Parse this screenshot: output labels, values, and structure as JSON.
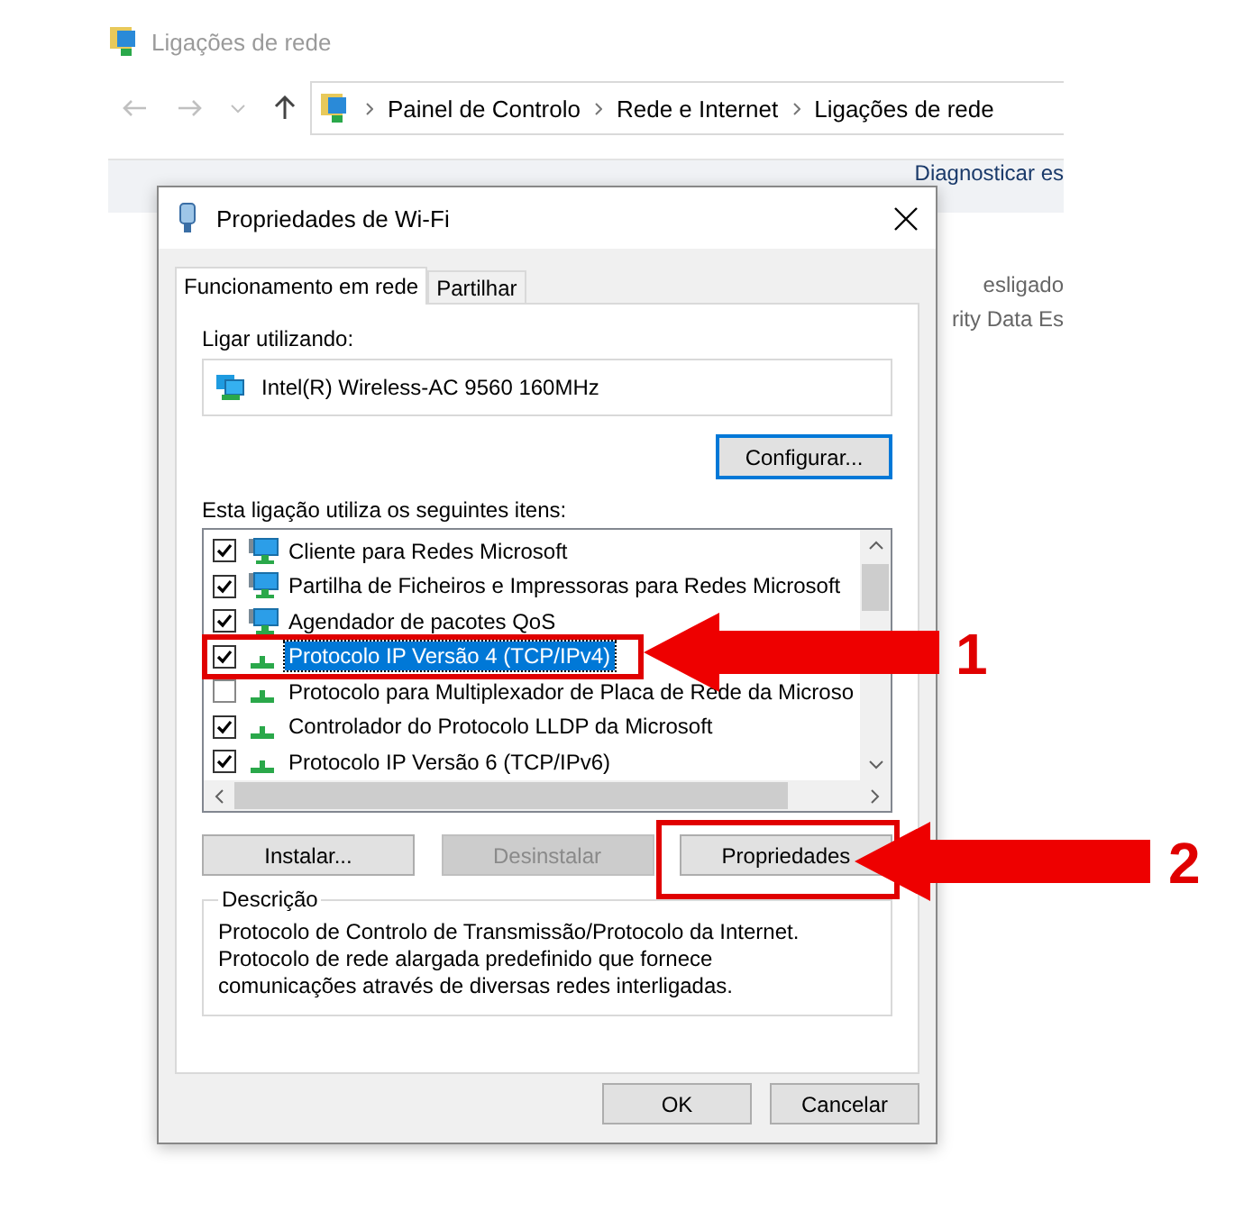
{
  "explorer": {
    "title": "Ligações de rede",
    "breadcrumb": [
      "Painel de Controlo",
      "Rede e Internet",
      "Ligações de rede"
    ],
    "toolbar_items": [
      "Diagnosticar es"
    ],
    "background_texts": [
      "esligado",
      "rity Data Es"
    ]
  },
  "dialog": {
    "title": "Propriedades de Wi-Fi",
    "tabs": [
      {
        "label": "Funcionamento em rede",
        "selected": true
      },
      {
        "label": "Partilhar",
        "selected": false
      }
    ],
    "connect_label": "Ligar utilizando:",
    "adapter": "Intel(R) Wireless-AC 9560 160MHz",
    "configure_button": "Configurar...",
    "items_label": "Esta ligação utiliza os seguintes itens:",
    "items": [
      {
        "label": "Cliente para Redes Microsoft",
        "checked": true,
        "selected": false,
        "kind": "client"
      },
      {
        "label": "Partilha de Ficheiros e Impressoras para Redes Microsoft",
        "checked": true,
        "selected": false,
        "kind": "client"
      },
      {
        "label": "Agendador de pacotes QoS",
        "checked": true,
        "selected": false,
        "kind": "client"
      },
      {
        "label": "Protocolo IP Versão 4 (TCP/IPv4)",
        "checked": true,
        "selected": true,
        "kind": "protocol"
      },
      {
        "label": "Protocolo para Multiplexador de Placa de Rede da Microso",
        "checked": false,
        "selected": false,
        "kind": "protocol"
      },
      {
        "label": "Controlador do Protocolo LLDP da Microsoft",
        "checked": true,
        "selected": false,
        "kind": "protocol"
      },
      {
        "label": "Protocolo IP Versão 6 (TCP/IPv6)",
        "checked": true,
        "selected": false,
        "kind": "protocol"
      }
    ],
    "buttons": [
      {
        "label": "Instalar...",
        "disabled": false
      },
      {
        "label": "Desinstalar",
        "disabled": true
      },
      {
        "label": "Propriedades",
        "disabled": false
      }
    ],
    "description": {
      "legend": "Descrição",
      "text": "Protocolo de Controlo de Transmissão/Protocolo da Internet. Protocolo de rede alargada predefinido que fornece comunicações através de diversas redes interligadas."
    },
    "footer_buttons": [
      "OK",
      "Cancelar"
    ]
  },
  "annotations": [
    {
      "number": "1"
    },
    {
      "number": "2"
    }
  ]
}
